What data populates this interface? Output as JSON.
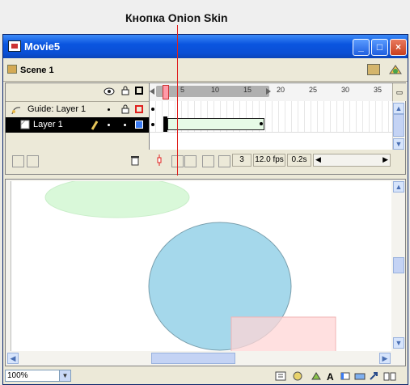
{
  "annotation": {
    "text": "Кнопка Onion Skin"
  },
  "window": {
    "title": "Movie5"
  },
  "scene": {
    "label": "Scene 1"
  },
  "timeline": {
    "ruler_ticks": [
      "5",
      "10",
      "15",
      "20",
      "25",
      "30",
      "35"
    ],
    "layers": [
      {
        "name": "Guide: Layer 1",
        "selected": false
      },
      {
        "name": "Layer 1",
        "selected": true
      }
    ],
    "current_frame": "3",
    "frame_rate": "12.0 fps",
    "elapsed_time": "0.2s"
  },
  "status": {
    "zoom": "100%"
  },
  "colors": {
    "ellipse_green": "#d9f8d9",
    "circle_blue": "#a5d8eb",
    "rect_pink": "#ffd6d6",
    "annotation_line": "#e0201d"
  }
}
